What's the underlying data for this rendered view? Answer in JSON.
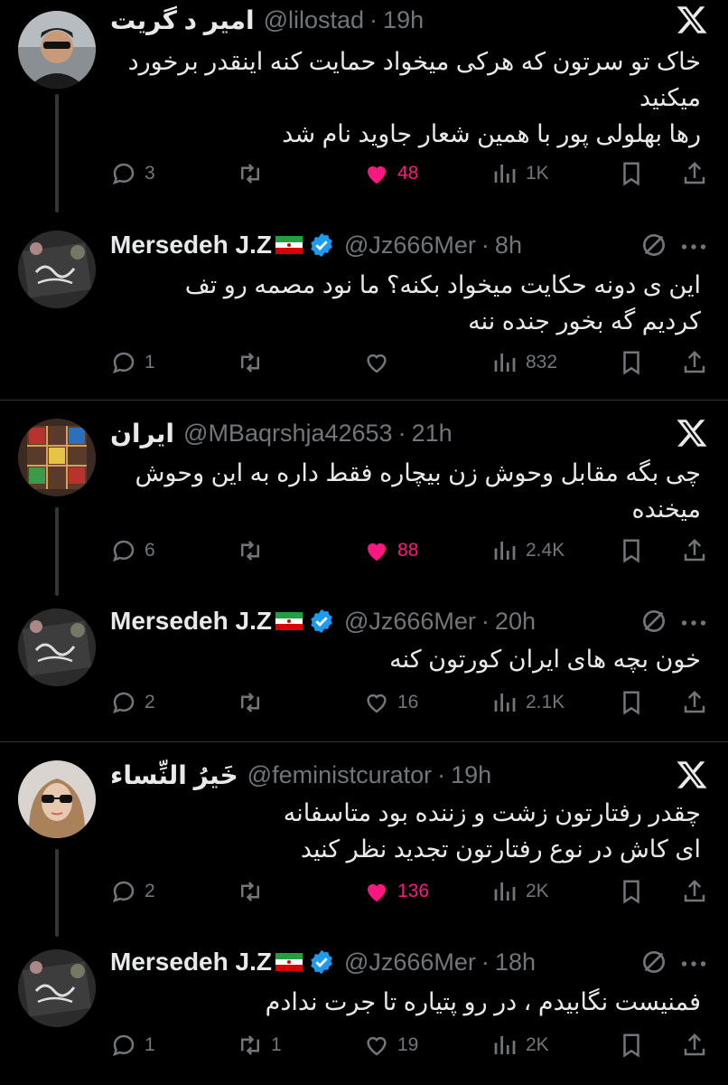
{
  "colors": {
    "background": "#000000",
    "text": "#e7e9ea",
    "muted": "#71767b",
    "like": "#f91880",
    "verified": "#1d9bf0",
    "divider": "#2f3336"
  },
  "icons": {
    "reply": "reply-icon",
    "retweet": "retweet-icon",
    "like": "heart-icon",
    "views": "views-icon",
    "bookmark": "bookmark-icon",
    "share": "share-icon",
    "x_logo": "x-logo-icon",
    "mute": "mute-icon",
    "more": "more-icon"
  },
  "tweets": [
    {
      "name": "امیر د گریت",
      "handle": "@lilostad",
      "time": "19h",
      "lines": [
        "خاک تو سرتون که هرکی میخواد حمایت کنه اینقدر برخورد",
        "میکنید",
        "رها بهلولی پور با همین شعار جاوید نام شد"
      ],
      "replies": "3",
      "retweets": "",
      "likes": "48",
      "views": "1K",
      "liked": true
    },
    {
      "name": "Mersedeh J.Z",
      "handle": "@Jz666Mer",
      "time": "8h",
      "lines": [
        "این ی دونه حکایت میخواد بکنه؟ ما نود مصمه رو تف",
        "کردیم گه بخور جنده ننه"
      ],
      "replies": "1",
      "retweets": "",
      "likes": "",
      "views": "832",
      "liked": false
    },
    {
      "name": "ایران",
      "handle": "@MBaqrshja42653",
      "time": "21h",
      "lines": [
        "چی بگه مقابل وحوش زن بیچاره فقط داره به این وحوش",
        "میخنده"
      ],
      "replies": "6",
      "retweets": "",
      "likes": "88",
      "views": "2.4K",
      "liked": true
    },
    {
      "name": "Mersedeh J.Z",
      "handle": "@Jz666Mer",
      "time": "20h",
      "lines": [
        "خون بچه های ایران کورتون کنه"
      ],
      "replies": "2",
      "retweets": "",
      "likes": "16",
      "views": "2.1K",
      "liked": false
    },
    {
      "name": "خَيرُ النِّساء",
      "handle": "@feministcurator",
      "time": "19h",
      "lines": [
        "چقدر رفتارتون زشت و زننده بود متاسفانه",
        "ای کاش در نوع رفتارتون تجدید نظر کنید"
      ],
      "replies": "2",
      "retweets": "",
      "likes": "136",
      "views": "2K",
      "liked": true
    },
    {
      "name": "Mersedeh J.Z",
      "handle": "@Jz666Mer",
      "time": "18h",
      "lines": [
        "فمنیست نگابیدم ، در رو پتیاره تا جرت ندادم"
      ],
      "replies": "1",
      "retweets": "1",
      "likes": "19",
      "views": "2K",
      "liked": false
    }
  ]
}
